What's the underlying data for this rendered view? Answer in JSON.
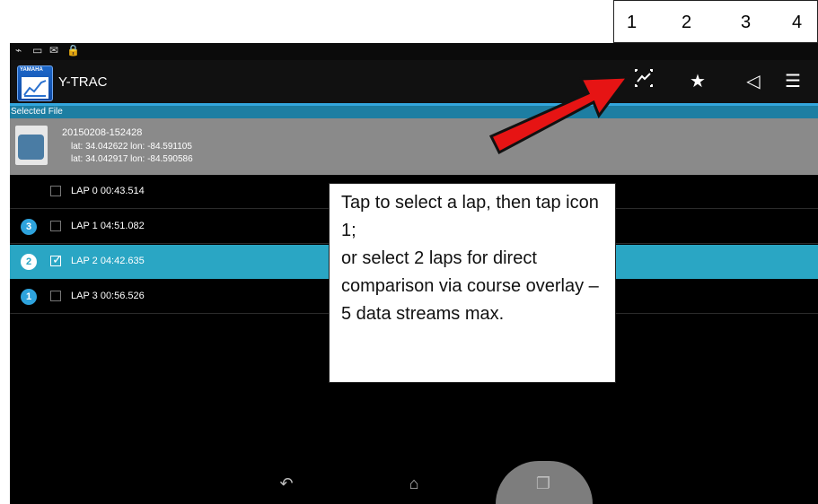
{
  "app": {
    "title": "Y-TRAC",
    "logo_brand": "YAMAHA"
  },
  "header": {
    "status_icons": [
      "wifi-icon",
      "message-icon",
      "mail-icon",
      "lock-icon"
    ]
  },
  "toolbar": {
    "actions": [
      "compare-laps-icon",
      "favorite-add-icon",
      "share-icon",
      "menu-icon"
    ]
  },
  "file": {
    "section_label": "Selected File",
    "name": "20150208-152428",
    "coord_1": "lat: 34.042622 lon: -84.591105",
    "coord_2": "lat: 34.042917 lon: -84.590586"
  },
  "laps": [
    {
      "label": "LAP  0  00:43.514",
      "badge": "",
      "checked": false,
      "selected": false
    },
    {
      "label": "LAP  1  04:51.082",
      "badge": "3",
      "checked": false,
      "selected": false
    },
    {
      "label": "LAP  2  04:42.635",
      "badge": "2",
      "checked": true,
      "selected": true
    },
    {
      "label": "LAP  3  00:56.526",
      "badge": "1",
      "checked": false,
      "selected": false
    }
  ],
  "numbers": [
    "1",
    "2",
    "3",
    "4"
  ],
  "callout": {
    "text": "Tap to select a lap, then tap icon 1;\nor select 2 laps for direct comparison via course overlay – 5 data streams max."
  },
  "nav": {
    "back_icon": "back-icon",
    "home_icon": "home-icon",
    "recent_icon": "recent-apps-icon"
  }
}
